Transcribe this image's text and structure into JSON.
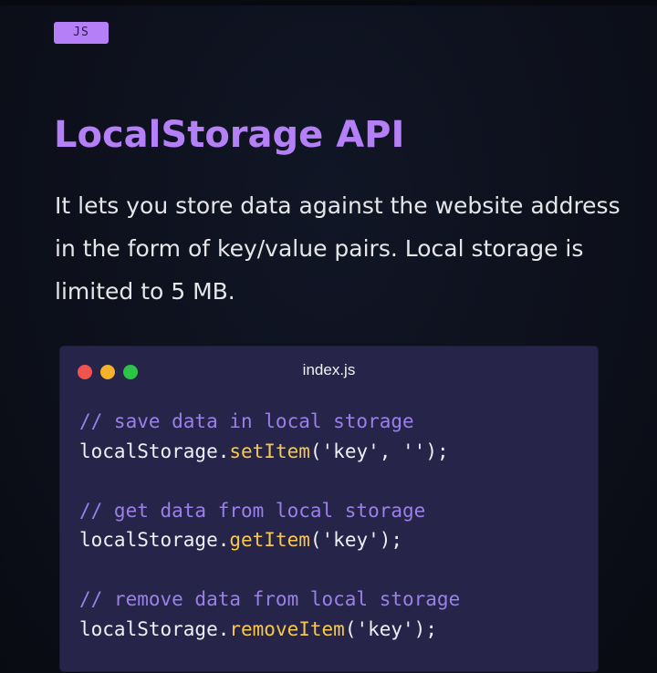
{
  "badge": {
    "label": "JS"
  },
  "title": "LocalStorage API",
  "description": "It lets you store data against the website address in the form of key/value pairs. Local storage is limited to 5 MB.",
  "code_window": {
    "filename": "index.js",
    "colors": {
      "close": "#f1544f",
      "minimize": "#f4b12b",
      "maximize": "#2cc445",
      "background": "#262549"
    },
    "blocks": [
      {
        "comment": "// save data in local storage",
        "object": "localStorage",
        "dot": ".",
        "method": "setItem",
        "args": "('key', '');"
      },
      {
        "comment": "// get data from local storage",
        "object": "localStorage",
        "dot": ".",
        "method": "getItem",
        "args": "('key');"
      },
      {
        "comment": "// remove data from local storage",
        "object": "localStorage",
        "dot": ".",
        "method": "removeItem",
        "args": "('key');"
      }
    ]
  },
  "theme": {
    "accent": "#b57ff7",
    "background": "#0f121d",
    "comment_color": "#9a80e8",
    "method_color": "#f7c84b"
  }
}
